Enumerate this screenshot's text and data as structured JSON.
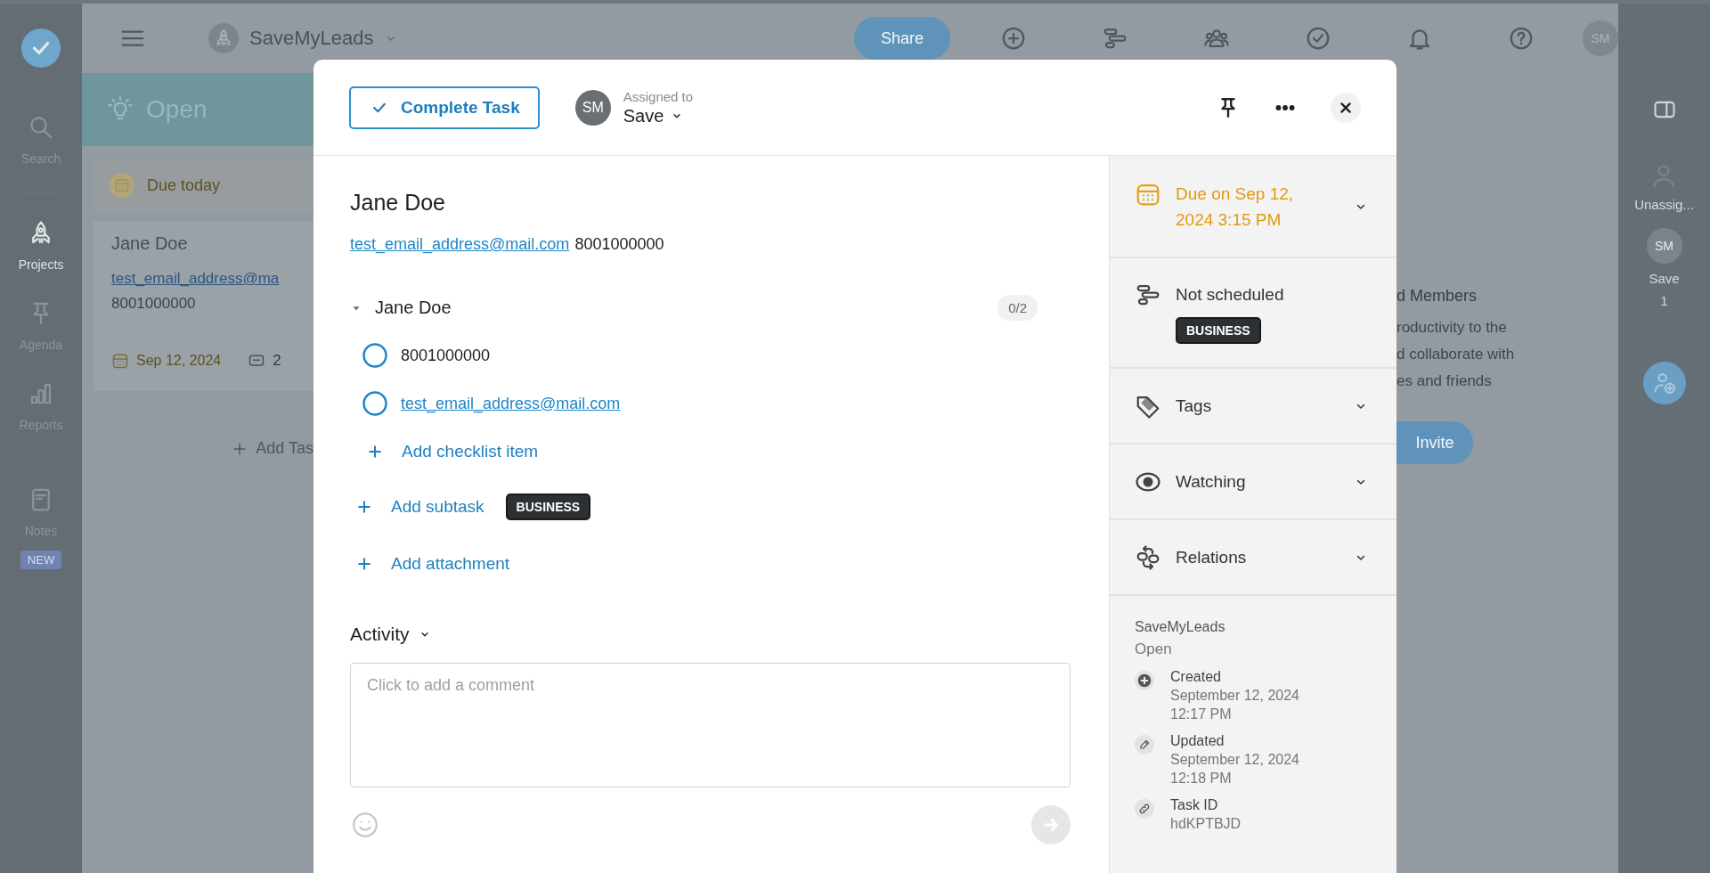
{
  "nav": {
    "items": [
      {
        "label": "Search",
        "kind": "search",
        "selected": false
      },
      {
        "label": "Projects",
        "kind": "rocket",
        "selected": true
      },
      {
        "label": "Agenda",
        "kind": "pin",
        "selected": false
      },
      {
        "label": "Reports",
        "kind": "chart",
        "selected": false
      },
      {
        "label": "Notes",
        "kind": "note",
        "selected": false,
        "badge": "NEW"
      }
    ]
  },
  "topbar": {
    "workspace": "SaveMyLeads",
    "share_button": "Share",
    "avatar": "SM"
  },
  "board": {
    "column_title": "Open",
    "group": "Due today",
    "card": {
      "title": "Jane Doe",
      "email": "test_email_address@ma",
      "phone": "8001000000",
      "due": "Sep 12, 2024",
      "comments": "2"
    },
    "add_task": "Add Tas"
  },
  "members_panel": {
    "title": "d Members",
    "lines": [
      "roductivity to the",
      "d collaborate with",
      "es and friends"
    ],
    "invite_button": "Invite"
  },
  "right_rail": {
    "assignees": [
      {
        "kind": "unassigned",
        "label": "Unassig..."
      },
      {
        "kind": "user",
        "initials": "SM",
        "label": "Save",
        "count": "1"
      }
    ]
  },
  "task": {
    "complete_button": "Complete Task",
    "assigned_label": "Assigned to",
    "assignee_initials": "SM",
    "assignee": "Save",
    "title": "Jane Doe",
    "email": "test_email_address@mail.com",
    "phone": "8001000000",
    "checklist": {
      "title": "Jane Doe",
      "expanded": true,
      "progress": "0/2",
      "items": [
        {
          "kind": "text",
          "text": "8001000000",
          "checked": false
        },
        {
          "kind": "link",
          "text": "test_email_address@mail.com",
          "checked": false
        }
      ],
      "add_item": "Add checklist item"
    },
    "add_subtask": "Add subtask",
    "subtask_badge": "BUSINESS",
    "add_attachment": "Add attachment",
    "activity": "Activity",
    "comment_placeholder": "Click to add a comment"
  },
  "details": {
    "due": "Due on Sep 12, 2024 3:15 PM",
    "schedule": "Not scheduled",
    "schedule_badge": "BUSINESS",
    "sections": [
      {
        "kind": "tags",
        "label": "Tags"
      },
      {
        "kind": "watching",
        "label": "Watching"
      },
      {
        "kind": "relations",
        "label": "Relations"
      }
    ],
    "project": "SaveMyLeads",
    "status": "Open",
    "meta": [
      {
        "kind": "created",
        "label": "Created",
        "value": "September 12, 2024",
        "time": "12:17 PM"
      },
      {
        "kind": "updated",
        "label": "Updated",
        "value": "September 12, 2024",
        "time": "12:18 PM"
      },
      {
        "kind": "id",
        "label": "Task ID",
        "value": "hdKPTBJD"
      }
    ]
  }
}
